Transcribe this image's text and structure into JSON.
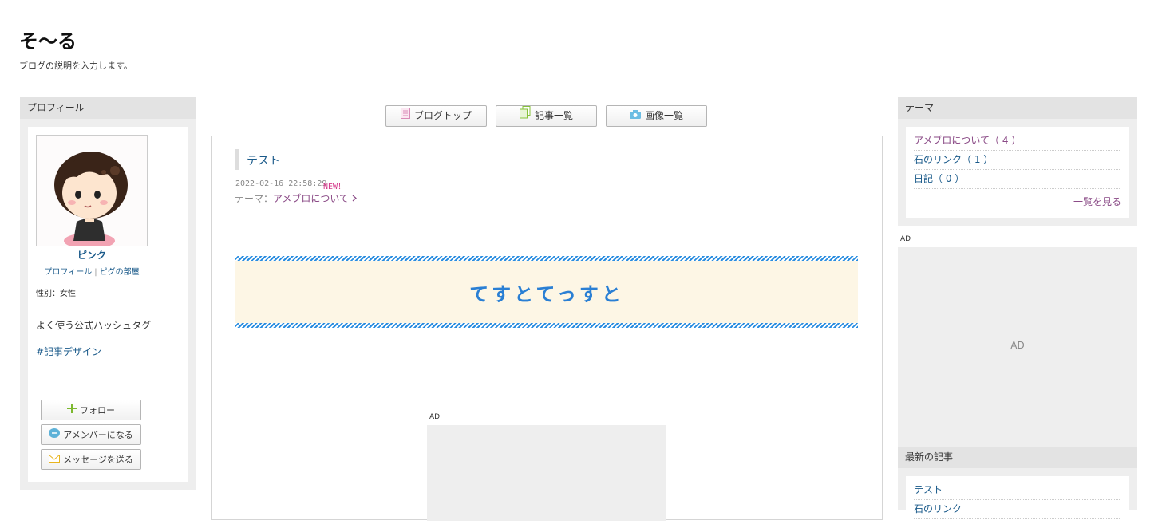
{
  "header": {
    "title": "そ〜る",
    "description": "ブログの説明を入力します。"
  },
  "nav": {
    "blog_top": {
      "label": "ブログトップ",
      "icon": "page-icon"
    },
    "entry_list": {
      "label": "記事一覧",
      "icon": "documents-icon"
    },
    "image_list": {
      "label": "画像一覧",
      "icon": "camera-icon"
    }
  },
  "profile": {
    "heading": "プロフィール",
    "name": "ピンク",
    "link_profile": "プロフィール",
    "link_room": "ピグの部屋",
    "gender": "性別：女性",
    "hashtag_heading": "よく使う公式ハッシュタグ",
    "hashtag": "#記事デザイン",
    "follow_label": "フォロー",
    "member_label": "アメンバーになる",
    "message_label": "メッセージを送る"
  },
  "entry": {
    "title": "テスト",
    "date": "2022-02-16 22:58:29",
    "new_badge": "NEW！",
    "theme_prefix": "テーマ：",
    "theme_name": "アメブロについて",
    "banner_text": "てすとてっすと",
    "ad_label": "AD"
  },
  "sidebar_right": {
    "theme_heading": "テーマ",
    "themes": [
      {
        "label": "アメブロについて（ 4 ）"
      },
      {
        "label": "石のリンク（ 1 ）"
      },
      {
        "label": "日記（ 0 ）"
      }
    ],
    "theme_more": "一覧を見る",
    "ad_label": "AD",
    "ad_text": "AD",
    "recent_heading": "最新の記事",
    "recent": [
      {
        "label": "テスト"
      },
      {
        "label": "石のリンク"
      }
    ]
  },
  "colors": {
    "link": "#1a5a8a",
    "accent_purple": "#8a4a86",
    "new_badge": "#d63a8c",
    "banner_text": "#2a7fd4",
    "banner_bg": "#fdf6e5"
  }
}
